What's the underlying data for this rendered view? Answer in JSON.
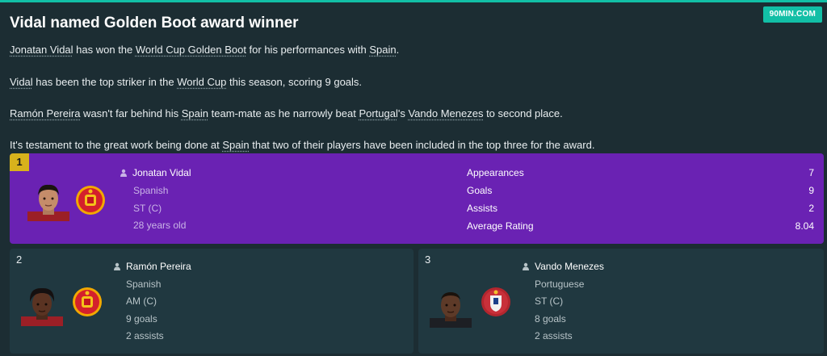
{
  "article": {
    "title": "Vidal named Golden Boot award winner",
    "source": "90MIN.COM",
    "paragraphs": [
      [
        {
          "text": "Jonatan Vidal",
          "link": true
        },
        {
          "text": " has won the ",
          "link": false
        },
        {
          "text": "World Cup Golden Boot",
          "link": true
        },
        {
          "text": " for his performances with ",
          "link": false
        },
        {
          "text": "Spain",
          "link": true
        },
        {
          "text": ".",
          "link": false
        }
      ],
      [
        {
          "text": "Vidal",
          "link": true
        },
        {
          "text": " has been the top striker in the ",
          "link": false
        },
        {
          "text": "World Cup",
          "link": true
        },
        {
          "text": " this season, scoring 9 goals.",
          "link": false
        }
      ],
      [
        {
          "text": "Ramón Pereira",
          "link": true
        },
        {
          "text": " wasn't far behind his ",
          "link": false
        },
        {
          "text": "Spain",
          "link": true
        },
        {
          "text": " team-mate as he narrowly beat ",
          "link": false
        },
        {
          "text": "Portugal",
          "link": true
        },
        {
          "text": "'s ",
          "link": false
        },
        {
          "text": "Vando Menezes",
          "link": true
        },
        {
          "text": " to second place.",
          "link": false
        }
      ],
      [
        {
          "text": "It's testament to the great work being done at ",
          "link": false
        },
        {
          "text": "Spain",
          "link": true
        },
        {
          "text": " that two of their players have been included in the top three for the award.",
          "link": false
        }
      ]
    ]
  },
  "winner": {
    "rank": "1",
    "name": "Jonatan Vidal",
    "nationality": "Spanish",
    "position": "ST (C)",
    "age": "28 years old",
    "stats": [
      {
        "label": "Appearances",
        "value": "7"
      },
      {
        "label": "Goals",
        "value": "9"
      },
      {
        "label": "Assists",
        "value": "2"
      },
      {
        "label": "Average Rating",
        "value": "8.04"
      }
    ]
  },
  "second": {
    "rank": "2",
    "name": "Ramón Pereira",
    "nationality": "Spanish",
    "position": "AM (C)",
    "goals": "9 goals",
    "assists": "2 assists"
  },
  "third": {
    "rank": "3",
    "name": "Vando Menezes",
    "nationality": "Portuguese",
    "position": "ST (C)",
    "goals": "8 goals",
    "assists": "2 assists"
  },
  "colors": {
    "background": "#1c2d33",
    "accent": "#12bfa6",
    "winner_card": "#6a22b3",
    "runner_card": "#203840",
    "rank_badge": "#d8b21c"
  },
  "icons": {
    "person": "person-icon",
    "spain_crest": "spain-crest-icon",
    "portugal_crest": "portugal-crest-icon"
  }
}
